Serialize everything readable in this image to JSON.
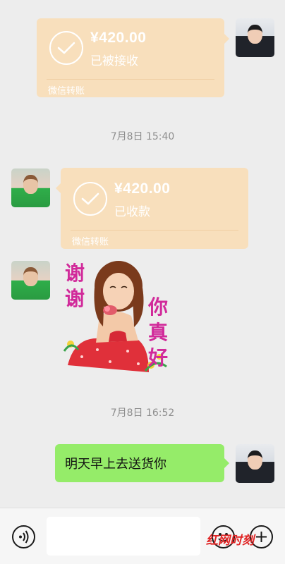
{
  "messages": {
    "transfer_sent": {
      "amount": "¥420.00",
      "status": "已被接收",
      "footer": "微信转账"
    },
    "time1": "7月8日 15:40",
    "transfer_received": {
      "amount": "¥420.00",
      "status": "已收款",
      "footer": "微信转账"
    },
    "sticker": {
      "left_text": "谢谢",
      "right_text": "你真好"
    },
    "time2": "7月8日 16:52",
    "text_sent": "明天早上去送货你"
  },
  "input_bar": {
    "placeholder": "",
    "voice_icon": "voice-icon",
    "emoji_icon": "emoji-icon",
    "more_icon": "plus-icon"
  },
  "watermark": "红网时刻",
  "colors": {
    "background": "#ededed",
    "transfer_bubble": "#f8dfbc",
    "text_bubble": "#95ec69",
    "timestamp": "#8e8e8e"
  }
}
